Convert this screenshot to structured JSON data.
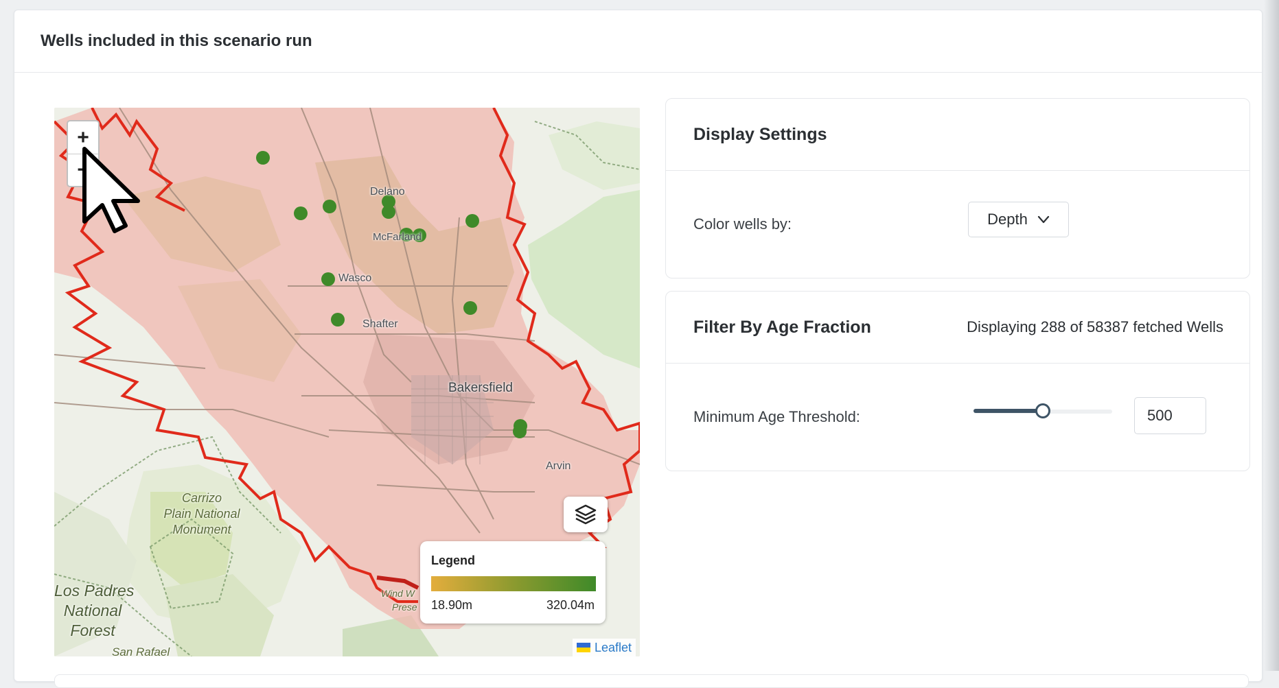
{
  "card": {
    "title": "Wells included in this scenario run"
  },
  "map": {
    "labels": {
      "delano": "Delano",
      "mcfarland": "McFarland",
      "wasco": "Wasco",
      "shafter": "Shafter",
      "bakersfield": "Bakersfield",
      "arvin": "Arvin",
      "carrizo_line1": "Carrizo",
      "carrizo_line2": "Plain National",
      "carrizo_line3": "Monument",
      "lospadres_line1": "Los Padres",
      "lospadres_line2": "National",
      "lospadres_line3": "Forest",
      "sanrafael": "San Rafael",
      "wind_preserve_1": "Wind W",
      "wind_preserve_2": "Prese"
    },
    "zoom_in": "+",
    "zoom_out": "−",
    "legend": {
      "title": "Legend",
      "min_label": "18.90m",
      "max_label": "320.04m",
      "gradient_colors": [
        "#e3ad3d",
        "#8c9a2f",
        "#3f8a29"
      ]
    },
    "attribution": "Leaflet",
    "well_color": "#3f8a29",
    "boundary_color": "#e02a1b"
  },
  "display_settings": {
    "title": "Display Settings",
    "color_label": "Color wells by:",
    "color_value": "Depth"
  },
  "age_filter": {
    "title": "Filter By Age Fraction",
    "info": "Displaying 288 of 58387 fetched Wells",
    "threshold_label": "Minimum Age Threshold:",
    "threshold_value": "500",
    "slider_fraction": 0.5
  }
}
